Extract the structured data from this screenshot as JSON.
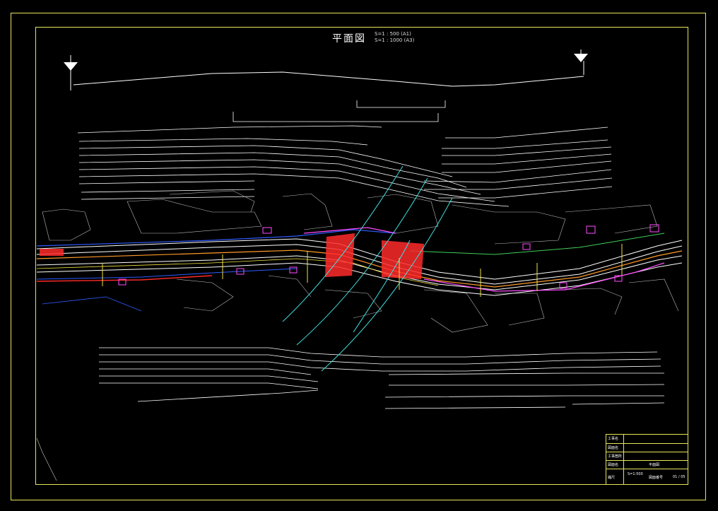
{
  "drawing": {
    "title": "平面図",
    "scale_line1": "S=1 : 500 (A1)",
    "scale_line2": "S=1 : 1000 (A3)"
  },
  "colors": {
    "frame": "#e6e65a",
    "road_white": "#ffffff",
    "red": "#ff2a2a",
    "magenta": "#ff4cff",
    "blue": "#2f5cff",
    "cyan": "#3fe0e0",
    "green": "#3fcf5a",
    "yellow": "#f0e040"
  },
  "title_block": {
    "rows": [
      {
        "label": "工事名",
        "value": ""
      },
      {
        "label": "図面名",
        "value": ""
      },
      {
        "label": "工事箇所",
        "value": ""
      },
      {
        "label": "図面名",
        "value": "平面図"
      },
      {
        "label": "縮尺",
        "value": "S=1:500",
        "sheet_label": "図面番号",
        "sheet": "01 / 05"
      }
    ]
  },
  "icons": {
    "north_left": "north-arrow-icon",
    "north_right": "north-arrow-icon"
  }
}
